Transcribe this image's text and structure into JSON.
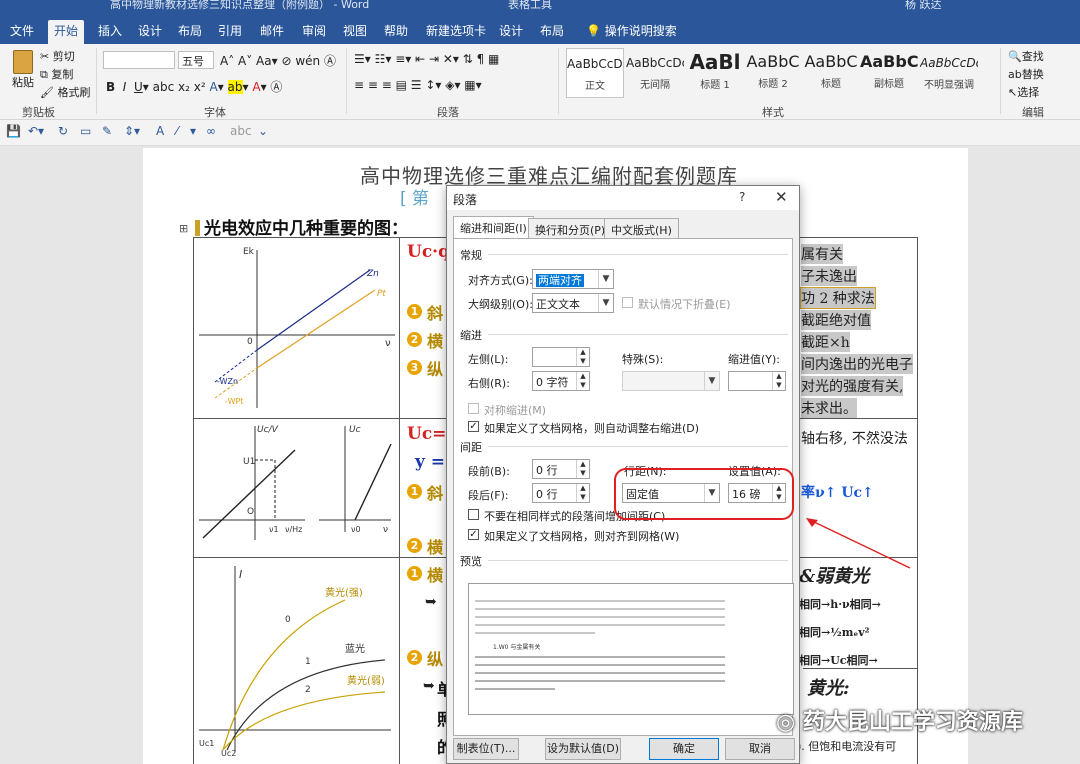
{
  "window": {
    "title": "高中物理新教材选修三知识点整理（附例题） - Word",
    "context_tab": "表格工具",
    "user": "杨 跃达"
  },
  "tabs": [
    "文件",
    "开始",
    "插入",
    "设计",
    "布局",
    "引用",
    "邮件",
    "审阅",
    "视图",
    "帮助",
    "新建选项卡",
    "设计",
    "布局",
    "操作说明搜索"
  ],
  "ribbon": {
    "clipboard": {
      "paste": "粘贴",
      "cut": "剪切",
      "copy": "复制",
      "format_painter": "格式刷",
      "label": "剪贴板"
    },
    "font": {
      "size": "五号",
      "label": "字体"
    },
    "paragraph": {
      "label": "段落"
    },
    "styles": {
      "label": "样式",
      "items": [
        {
          "preview": "AaBbCcDc",
          "name": "正文"
        },
        {
          "preview": "AaBbCcDc",
          "name": "无间隔"
        },
        {
          "preview": "AaBl",
          "name": "标题 1"
        },
        {
          "preview": "AaBbC",
          "name": "标题 2"
        },
        {
          "preview": "AaBbC",
          "name": "标题"
        },
        {
          "preview": "AaBbC",
          "name": "副标题"
        },
        {
          "preview": "AaBbCcDc",
          "name": "不明显强调"
        }
      ]
    },
    "editing": {
      "find": "查找",
      "replace": "替换",
      "select": "选择",
      "label": "编辑"
    }
  },
  "document": {
    "title": "高中物理选修三重难点汇编附配套例题库",
    "subtitle": "[ 第",
    "heading": "光电效应中几种重要的图：",
    "right_col": [
      "属有关",
      "子未逸出",
      "功 2 种求法",
      "截距绝对值",
      "截距×h",
      "间内逸出的光电子",
      "对光的强度有关,",
      "未求出。"
    ],
    "row2_right": "轴右移, 不然没法",
    "row2_formula": "率ν↑ Uc↑",
    "row3_title": "&弱黄光",
    "row3_l1": "相同→h·ν相同→",
    "row3_l2": "相同→½mₑv²",
    "row3_l3": "相同→Uc相同→",
    "row4_title": "黄光:",
    "bottom_right": "). 但饱和电流没有可",
    "formula_uq": "Uc·q",
    "formula_uc": "Uc=",
    "formula_y": "y =",
    "item_slope": "斜",
    "item_horiz": "横",
    "item_vert": "纵",
    "item_dan": "单",
    "item_zhao": "照",
    "item_de": "的",
    "graph1_labels": {
      "ek": "Ek",
      "zn": "Zn",
      "pt": "Pt",
      "v": "ν",
      "o": "0",
      "wzn": "-WZn",
      "wpt": "-WPt"
    },
    "graph2_labels": {
      "uc1": "Uc/V",
      "uc": "Uc",
      "u1": "U1",
      "o": "O",
      "v1": "ν1",
      "vhz": "ν/Hz",
      "v0": "ν0",
      "v": "ν"
    },
    "graph3_labels": {
      "i": "I",
      "yellow_strong": "黄光(强)",
      "blue": "蓝光",
      "yellow_weak": "黄光(弱)",
      "u0": "0",
      "u1": "1",
      "u2": "2",
      "uc1": "Uc1",
      "uc2": "Uc2"
    }
  },
  "dialog": {
    "title": "段落",
    "help": "?",
    "tabs": [
      "缩进和间距(I)",
      "换行和分页(P)",
      "中文版式(H)"
    ],
    "general": "常规",
    "alignment_label": "对齐方式(G):",
    "alignment_value": "两端对齐",
    "outline_label": "大纲级别(O):",
    "outline_value": "正文文本",
    "collapse_label": "默认情况下折叠(E)",
    "indent": "缩进",
    "left_label": "左侧(L):",
    "left_value": "",
    "right_label": "右侧(R):",
    "right_value": "0 字符",
    "special_label": "特殊(S):",
    "special_value": "",
    "indent_by_label": "缩进值(Y):",
    "indent_by_value": "",
    "mirror_label": "对称缩进(M)",
    "auto_adjust_label": "如果定义了文档网格，则自动调整右缩进(D)",
    "spacing": "间距",
    "before_label": "段前(B):",
    "before_value": "0 行",
    "after_label": "段后(F):",
    "after_value": "0 行",
    "line_spacing_label": "行距(N):",
    "line_spacing_value": "固定值",
    "at_label": "设置值(A):",
    "at_value": "16 磅",
    "no_space_label": "不要在相同样式的段落间增加间距(C)",
    "snap_grid_label": "如果定义了文档网格，则对齐到网格(W)",
    "preview": "预览",
    "preview_sample": "1.W0 与金属有关",
    "buttons": {
      "tabs": "制表位(T)...",
      "default": "设为默认值(D)",
      "ok": "确定",
      "cancel": "取消"
    }
  },
  "watermark": "药大昆山工学习资源库",
  "colors": {
    "accent": "#2b579a",
    "highlight_red": "#e02020"
  }
}
